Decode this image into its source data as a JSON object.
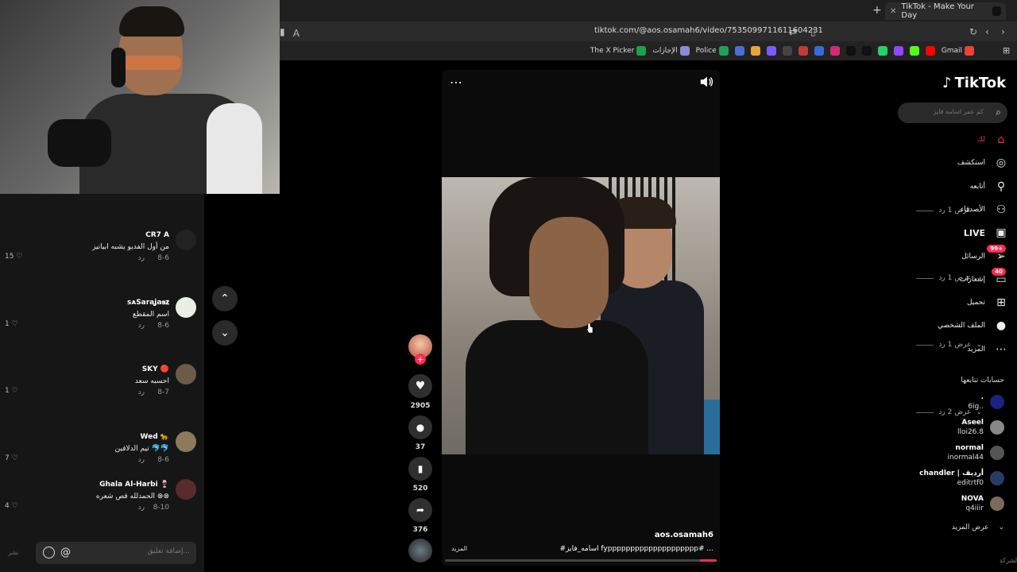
{
  "browser": {
    "tab_title": "TikTok - Make Your Day",
    "url": "tiktok.com/@aos.osamah6/video/7535099711611604231",
    "bookmarks": [
      {
        "label": "The X Picker",
        "color": "#17a34a"
      },
      {
        "label": "الإجازات",
        "color": "#8b8bd8"
      },
      {
        "label": "Police",
        "color": "#22a055"
      },
      {
        "label": "",
        "color": "#4b6ed8"
      },
      {
        "label": "",
        "color": "#e8a33a"
      },
      {
        "label": "",
        "color": "#7a5cff"
      },
      {
        "label": "",
        "color": "#444"
      },
      {
        "label": "",
        "color": "#c23a3a"
      },
      {
        "label": "",
        "color": "#3a6ad8"
      },
      {
        "label": "",
        "color": "#d62976"
      },
      {
        "label": "",
        "color": "#111"
      },
      {
        "label": "",
        "color": "#111"
      },
      {
        "label": "",
        "color": "#25d366"
      },
      {
        "label": "",
        "color": "#9146ff"
      },
      {
        "label": "",
        "color": "#53fc18"
      },
      {
        "label": "",
        "color": "#ff0000"
      },
      {
        "label": "Gmail",
        "color": "#ea4335"
      }
    ]
  },
  "comments": {
    "reply_toggles": [
      "عرض 1 رد",
      "عرض 1 رد",
      "عرض 1 رد",
      "عرض 2 رد"
    ],
    "reply_label": "رد",
    "items": [
      {
        "name": "CR7 A",
        "text": "من أول الفديو يشبه ابيانيز",
        "date": "8-6",
        "likes": "15",
        "avatar": "#222"
      },
      {
        "name": "ꜱᴀSaraʝa𝐬𝐳",
        "text": "اسم المقطع",
        "date": "8-6",
        "likes": "1",
        "avatar": "#e9efe6"
      },
      {
        "name": "SKY 🔴",
        "text": "احسبه سعد",
        "date": "8-7",
        "likes": "1",
        "avatar": "#6b5b4a"
      },
      {
        "name": "Wed 🐆",
        "text": "تيم الدلافين 🐬🐬",
        "date": "8-6",
        "likes": "7",
        "avatar": "#8b7a5c"
      },
      {
        "name": "Ghala Al-Harbi 🍷",
        "text": "الحمدلله قص شعره ⊗⊗",
        "date": "8-10",
        "likes": "4",
        "avatar": "#5a2b2b"
      }
    ],
    "input_placeholder": "إضافة تعليق...",
    "post_label": "نشر"
  },
  "video": {
    "author": "aos.osamah6",
    "caption": "#اسامه_فايز fypppppppppppppppppppp# ...",
    "more_label": "المزيد",
    "progress": 0.06
  },
  "actions": {
    "likes": "2905",
    "comments": "37",
    "saves": "520",
    "shares": "376"
  },
  "sidebar": {
    "logo": "TikTok",
    "search_placeholder": "كم عمر اسامه فايز",
    "nav": [
      {
        "label": "لك",
        "icon": "home-icon",
        "active": true
      },
      {
        "label": "استكشف",
        "icon": "compass-icon"
      },
      {
        "label": "أتابعه",
        "icon": "following-icon"
      },
      {
        "label": "الأصدقاء",
        "icon": "friends-icon"
      },
      {
        "label": "LIVE",
        "icon": "live-icon"
      },
      {
        "label": "الرسائل",
        "icon": "messages-icon",
        "badge": "99+"
      },
      {
        "label": "إشعارات",
        "icon": "notifications-icon",
        "badge": "40"
      },
      {
        "label": "تحميل",
        "icon": "upload-icon"
      },
      {
        "label": "الملف الشخصي",
        "icon": "profile-icon"
      },
      {
        "label": "المزيد",
        "icon": "more-icon"
      }
    ],
    "following_title": "حسابات تتابعها",
    "following": [
      {
        "name": ".",
        "user": "6ig..",
        "color": "#1a237e"
      },
      {
        "name": "Aseel",
        "user": "lloi26.8",
        "color": "#888"
      },
      {
        "name": "normal",
        "user": "inormal44",
        "color": "#555"
      },
      {
        "name": "chandler | أرديف",
        "user": "editrtf0",
        "color": "#2a3c66"
      },
      {
        "name": "NOVA",
        "user": "q4iiir",
        "color": "#7a6a5a"
      }
    ],
    "show_more": "عرض المزيد",
    "company": "الشركة"
  }
}
